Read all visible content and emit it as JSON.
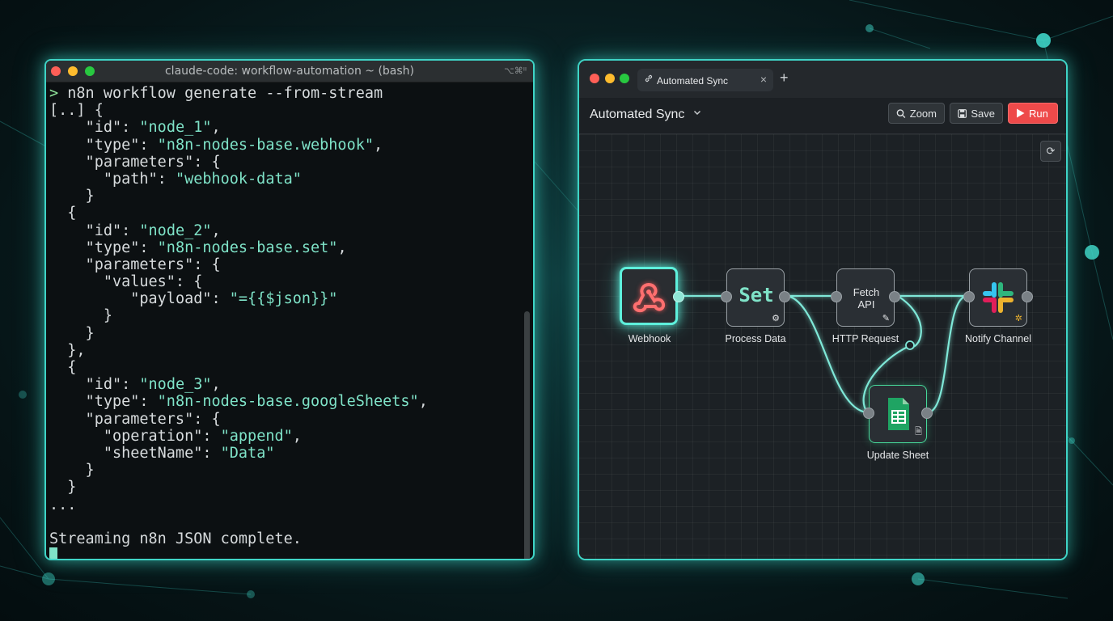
{
  "terminal": {
    "title": "claude-code: workflow-automation ~ (bash)",
    "shortcut": "⌥⌘ᐦ",
    "lines": [
      "> n8n workflow generate --from-stream",
      "[..] {",
      "    \"id\": \"node_1\",",
      "    \"type\": \"n8n-nodes-base.webhook\",",
      "    \"parameters\": {",
      "      \"path\": \"webhook-data\"",
      "    }",
      "  {",
      "    \"id\": \"node_2\",",
      "    \"type\": \"n8n-nodes-base.set\",",
      "    \"parameters\": {",
      "      \"values\": {",
      "         \"payload\": \"={{$json}}\"",
      "      }",
      "    }",
      "  },",
      "  {",
      "    \"id\": \"node_3\",",
      "    \"type\": \"n8n-nodes-base.googleSheets\",",
      "    \"parameters\": {",
      "      \"operation\": \"append\",",
      "      \"sheetName\": \"Data\"",
      "    }",
      "  }",
      "...",
      "",
      "Streaming n8n JSON complete."
    ]
  },
  "n8n": {
    "tab_label": "Automated Sync",
    "tab_close": "×",
    "tab_add": "+",
    "workflow_name": "Automated Sync",
    "chevron": "⌄",
    "buttons": {
      "zoom": "Zoom",
      "save": "Save",
      "run": "Run"
    },
    "nodes": {
      "webhook": "Webhook",
      "set_text": "Set",
      "process_data": "Process Data",
      "fetch_line1": "Fetch",
      "fetch_line2": "API",
      "http_request": "HTTP Request",
      "notify_channel": "Notify Channel",
      "update_sheet": "Update Sheet"
    }
  },
  "colors": {
    "accent": "#3fd4c6",
    "run_button": "#ee4a4a",
    "string": "#7fe3c8"
  }
}
